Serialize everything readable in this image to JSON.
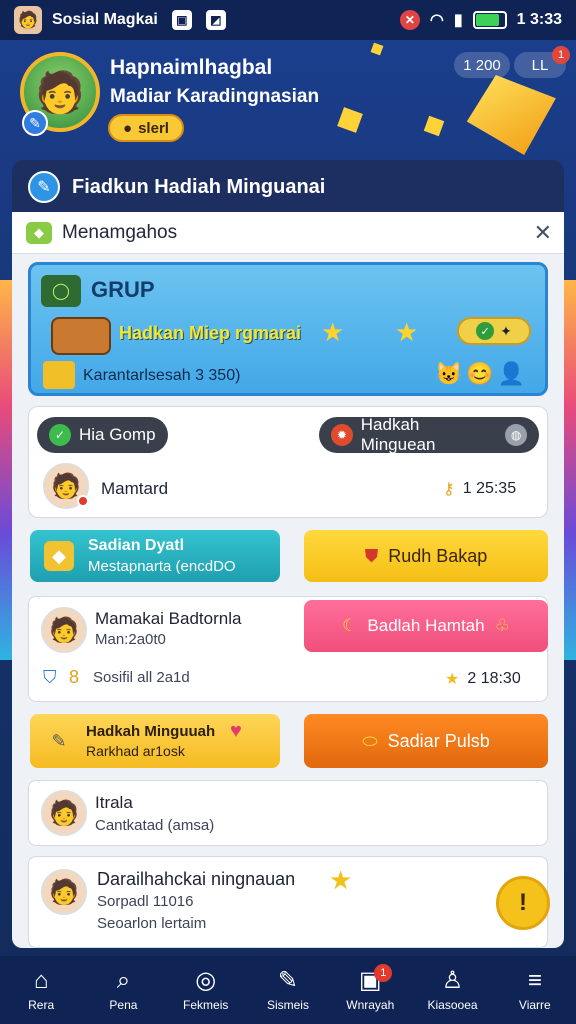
{
  "status_bar": {
    "app_name": "Sosial Magkai",
    "time": "1 3:33"
  },
  "header": {
    "title_line1": "Hapnaimlhagbal",
    "title_line2": "Madiar Karadingnasian",
    "start_label": "slerl",
    "coins": "1 200",
    "level": "LL",
    "level_badge": "1"
  },
  "panel": {
    "header_title": "Fiadkun Hadiah Minguanai",
    "subheader": "Menamgahos"
  },
  "grup": {
    "label": "GRUP",
    "reward_text": "Hadkan Miep rgmarai",
    "info": "Karantarlsesah 3 350)"
  },
  "group_card": {
    "left_pill": "Hia Gomp",
    "right_pill": "Hadkah Minguean",
    "member_name": "Mamtard",
    "time": "1 25:35"
  },
  "buttons": {
    "teal_title": "Sadian Dyatl",
    "teal_sub": "Mestapnarta (encdDO",
    "yellow_label": "Rudh Bakap",
    "pink_label": "Badlah Hamtah",
    "yellow2_title": "Hadkah Minguuah",
    "yellow2_sub": "Rarkhad ar1osk",
    "orange_label": "Sadiar Pulsb"
  },
  "card_member": {
    "name": "Mamakai Badtornla",
    "date": "Man:2a0t0",
    "sub": "Sosifil all 2a1d",
    "time": "2 18:30"
  },
  "card_itrala": {
    "name": "Itrala",
    "sub": "Cantkatad (amsa)"
  },
  "card_last": {
    "name": "Darailhahckai ningnauan",
    "line2": "Sorpadl 11016",
    "line3": "Seoarlon lertaim"
  },
  "fab_label": "!",
  "bottom_nav": [
    {
      "label": "Rera",
      "icon": "home-icon",
      "glyph": "⌂"
    },
    {
      "label": "Pena",
      "icon": "search-icon",
      "glyph": "⌕"
    },
    {
      "label": "Fekmeis",
      "icon": "compass-icon",
      "glyph": "◎"
    },
    {
      "label": "Sismeis",
      "icon": "brush-icon",
      "glyph": "✎"
    },
    {
      "label": "Wnrayah",
      "icon": "inbox-icon",
      "glyph": "▣",
      "badge": "1"
    },
    {
      "label": "Kiasooea",
      "icon": "profile-icon",
      "glyph": "♙"
    },
    {
      "label": "Viarre",
      "icon": "menu-icon",
      "glyph": "≡"
    }
  ]
}
